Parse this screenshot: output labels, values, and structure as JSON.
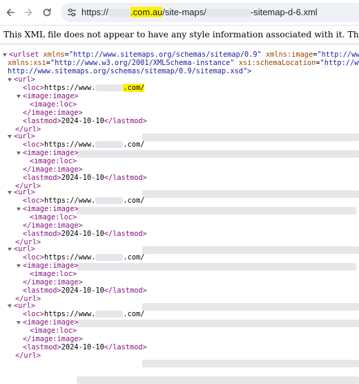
{
  "browser": {
    "url_prefix": "https://",
    "url_domain_suffix": ".com.au",
    "url_path": "/site-maps/",
    "url_file": "-sitemap-d-6.xml"
  },
  "notice": "This XML file does not appear to have any style information associated with it. The document tree is shown below.",
  "xml": {
    "urlset_open": "<urlset",
    "urlset_ns_attr": "xmlns",
    "urlset_ns_val": "\"http://www.sitemaps.org/schemas/sitemap/0.9\"",
    "urlset_img_attr": "xmlns:image",
    "urlset_img_val": "\"http://www.",
    "urlset_xsi_attr": "xmlns:xsi",
    "urlset_xsi_val": "\"http://www.w3.org/2001/XMLSchema-instance\"",
    "urlset_schema_attr": "xsi:schemaLocation",
    "urlset_schema_val": "\"http://www.",
    "urlset_line3": "http://www.sitemaps.org/schemas/sitemap/0.9/sitemap.xsd\">",
    "url_open": "<url>",
    "url_close": "</url>",
    "loc_open": "<loc>",
    "loc_prefix": "https://www.",
    "loc_suffix": ".com/",
    "image_open": "<image:image>",
    "image_close": "</image:image>",
    "imgloc_open": "<image:loc>",
    "lastmod_open": "<lastmod>",
    "lastmod_close": "</lastmod>",
    "lastmod_value": "2024-10-10"
  }
}
